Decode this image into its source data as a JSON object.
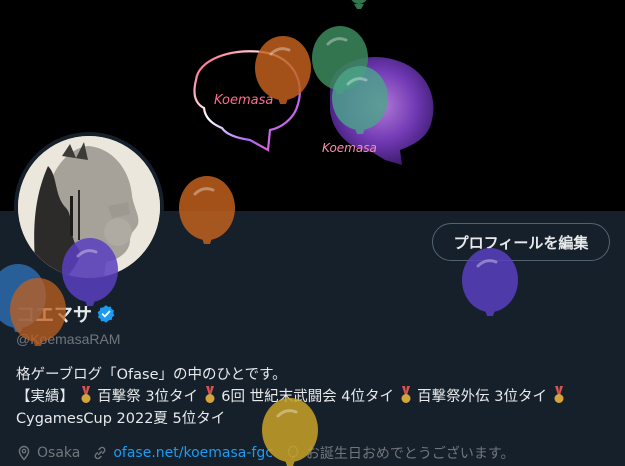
{
  "banner": {
    "logo_text_1": "Koemasa",
    "logo_text_2": "Koemasa"
  },
  "profile": {
    "edit_button_label": "プロフィールを編集",
    "display_name": "コエマサ",
    "handle": "@KoemasaRAM",
    "bio_line_1": "格ゲーブログ「Ofase」の中のひとです。",
    "bio_line_2_parts": [
      "【実績】",
      "百撃祭 3位タイ",
      "6回 世紀末武闘会 4位タイ",
      "百撃祭外伝 3位タイ"
    ],
    "bio_line_3": "CygamesCup 2022夏 5位タイ",
    "location": "Osaka",
    "website": "ofase.net/koemasa-fgc",
    "birthday_text": "お誕生日おめでとうございます。"
  },
  "icons": {
    "verified": "verified-badge-icon",
    "location": "location-pin-icon",
    "link": "link-icon",
    "balloon": "balloon-icon"
  },
  "colors": {
    "background": "#15202b",
    "banner": "#000000",
    "accent": "#1d9bf0",
    "muted": "#71767b",
    "balloon_orange": "#c0601e",
    "balloon_green": "#3b8a5c",
    "balloon_purple": "#5a3fc0",
    "balloon_blue": "#2f6fb5",
    "balloon_yellow": "#c9a227"
  }
}
